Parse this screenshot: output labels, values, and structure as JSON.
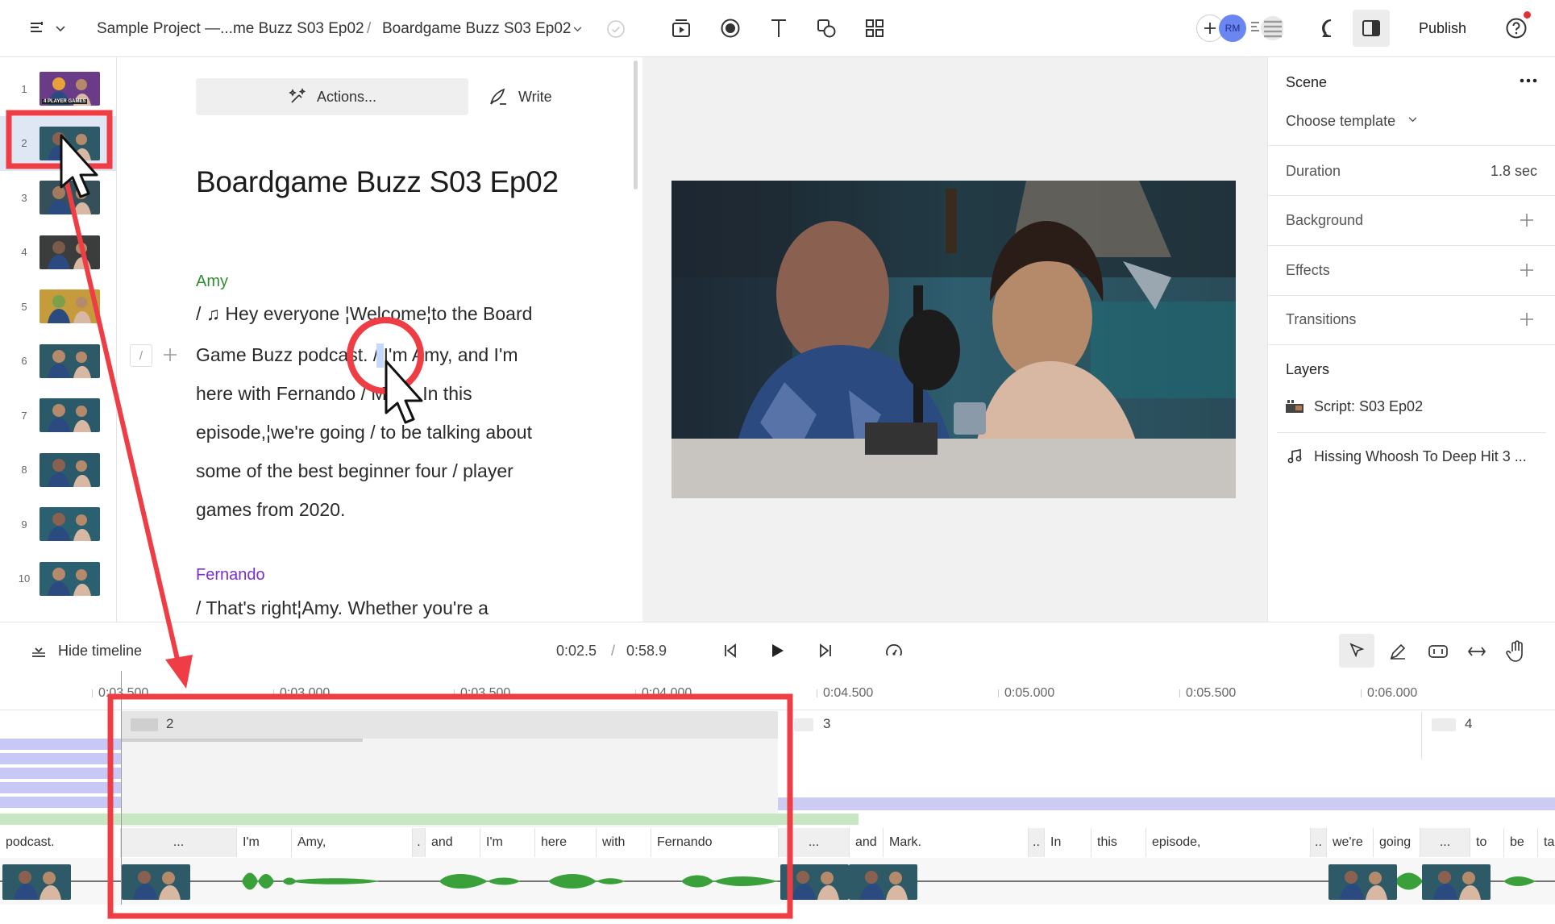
{
  "topbar": {
    "breadcrumb_project": "Sample Project —...me Buzz S03 Ep02",
    "breadcrumb_sep": "/",
    "breadcrumb_doc": "Boardgame Buzz S03 Ep02",
    "avatar_initials": "RM",
    "publish_label": "Publish",
    "accent": "#e03131"
  },
  "thumbnails": [
    {
      "num": "1",
      "caption": "4 PLAYER GAMES"
    },
    {
      "num": "2"
    },
    {
      "num": "3"
    },
    {
      "num": "4"
    },
    {
      "num": "5"
    },
    {
      "num": "6"
    },
    {
      "num": "7"
    },
    {
      "num": "8"
    },
    {
      "num": "9"
    },
    {
      "num": "10"
    }
  ],
  "script": {
    "actions_label": "Actions...",
    "write_label": "Write",
    "title": "Boardgame Buzz S03 Ep02",
    "speaker1": "Amy",
    "speaker1_color": "#2f8f2f",
    "speaker2": "Fernando",
    "speaker2_color": "#7b2fd0",
    "lines": [
      "/  ♫   Hey everyone ¦Welcome¦to the Board",
      "Game Buzz podcast. /   I'm Amy, and I'm",
      "here with Fernando /    Mark. In this",
      "episode,¦we're going / to be talking about",
      "some of the best beginner four / player",
      "games from 2020."
    ],
    "line2": "/ That's right¦Amy. Whether you're a",
    "gutter_slash": "/"
  },
  "rightpanel": {
    "scene_label": "Scene",
    "template_label": "Choose template",
    "duration_label": "Duration",
    "duration_value": "1.8 sec",
    "background_label": "Background",
    "effects_label": "Effects",
    "transitions_label": "Transitions",
    "layers_label": "Layers",
    "layer1": "Script: S03 Ep02",
    "layer2": "Hissing Whoosh To Deep Hit 3 ..."
  },
  "timeline": {
    "hide_label": "Hide timeline",
    "current_time": "0:02.5",
    "time_sep": "/",
    "total_time": "0:58.9",
    "ruler_ticks": [
      "0:03.500",
      "0:03.000",
      "0:03.500",
      "0:04.000",
      "0:04.500",
      "0:05.000",
      "0:05.500",
      "0:06.000"
    ],
    "scene2": "2",
    "scene3": "3",
    "scene4": "4",
    "words": [
      "podcast.",
      "...",
      "I'm",
      "Amy,",
      ".",
      "and",
      "I'm",
      "here",
      "with",
      "Fernando",
      "...",
      "and",
      "Mark.",
      "..",
      "In",
      "this",
      "episode,",
      "..",
      "we're",
      "going",
      "...",
      "to",
      "be",
      "tal"
    ]
  }
}
